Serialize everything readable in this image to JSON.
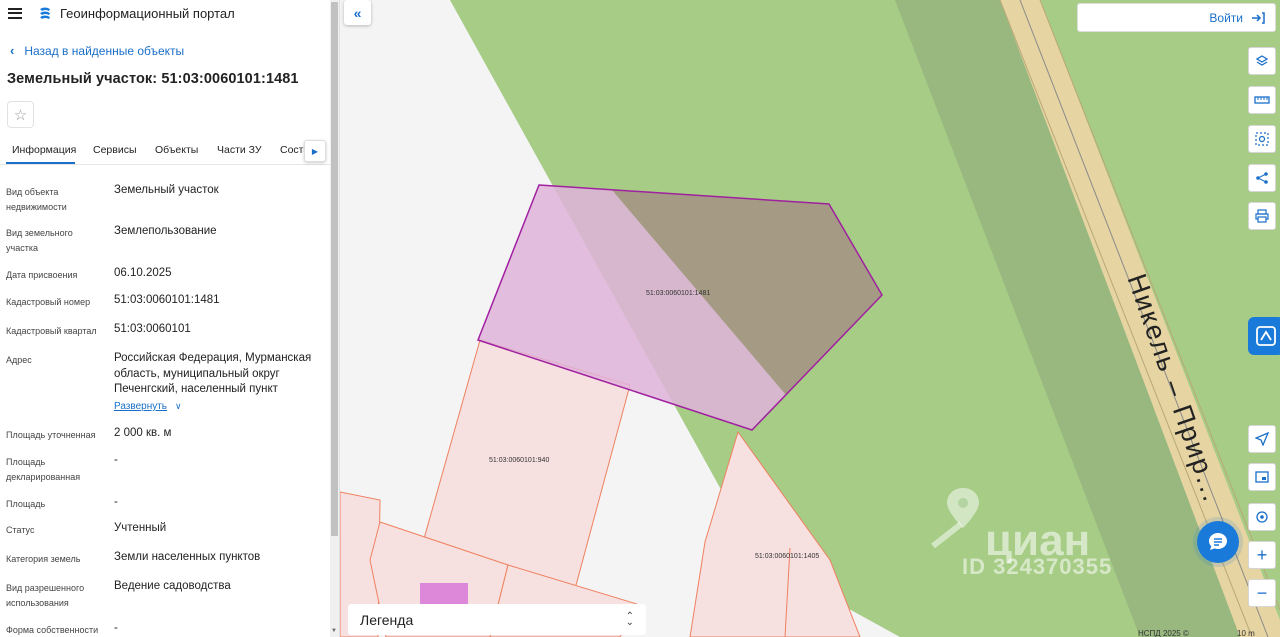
{
  "app": {
    "title": "Геоинформационный портал"
  },
  "nav": {
    "back_label": "Назад в найденные объекты"
  },
  "parcel": {
    "title": "Земельный участок: 51:03:0060101:1481"
  },
  "tabs": [
    {
      "label": "Информация",
      "active": true
    },
    {
      "label": "Сервисы"
    },
    {
      "label": "Объекты"
    },
    {
      "label": "Части ЗУ"
    },
    {
      "label": "Соста..."
    }
  ],
  "properties": [
    {
      "label": "Вид объекта недвижимости",
      "value": "Земельный участок"
    },
    {
      "label": "Вид земельного участка",
      "value": "Землепользование"
    },
    {
      "label": "Дата присвоения",
      "value": "06.10.2025"
    },
    {
      "label": "Кадастровый номер",
      "value": "51:03:0060101:1481"
    },
    {
      "label": "Кадастровый квартал",
      "value": "51:03:0060101"
    },
    {
      "label": "Адрес",
      "value": "Российская Федерация, Мурманская область, муниципальный округ Печенгский, населенный пункт"
    },
    {
      "label": "Площадь уточненная",
      "value": "2 000 кв. м"
    },
    {
      "label": "Площадь декларированная",
      "value": "-"
    },
    {
      "label": "Площадь",
      "value": "-"
    },
    {
      "label": "Статус",
      "value": "Учтенный"
    },
    {
      "label": "Категория земель",
      "value": "Земли населенных пунктов"
    },
    {
      "label": "Вид разрешенного использования",
      "value": "Ведение садоводства"
    },
    {
      "label": "Форма собственности",
      "value": "-"
    }
  ],
  "expand_label": "Развернуть",
  "map": {
    "login_label": "Войти",
    "legend_label": "Легенда",
    "road_name": "Никель – Прир...",
    "parcels": [
      "51:03:0060101:1481",
      "51:03:0060101:940",
      "51:03:0060101:1405"
    ],
    "watermark_brand": "циан",
    "watermark_id": "ID 324370355",
    "attribution": "НСПД 2025 ©",
    "scale": "10 m",
    "colors": {
      "green": "#a6cc86",
      "road": "#e6d4a2",
      "selected": "#dfb3d9",
      "parcel": "#f7e1e0",
      "accent": "#1a7ad9"
    }
  },
  "tools": [
    "layers-icon",
    "ruler-icon",
    "select-area-icon",
    "share-icon",
    "print-icon",
    "locate-icon",
    "minimap-icon",
    "tracking-icon",
    "zoom-in-icon",
    "zoom-out-icon"
  ]
}
